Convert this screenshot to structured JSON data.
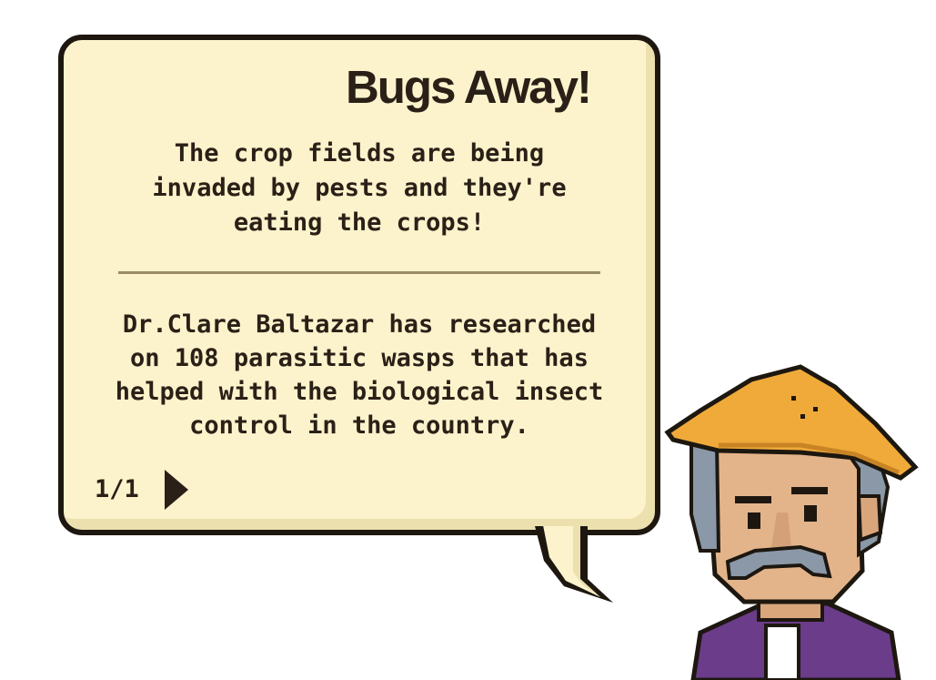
{
  "dialog": {
    "title": "Bugs Away!",
    "intro": "The crop fields are being invaded by pests and they're eating the crops!",
    "fact": "Dr.Clare Baltazar has researched on 108 parasitic wasps that has helped with the biological insect control in the country.",
    "page_counter": "1/1",
    "next_icon": "play-arrow-icon"
  },
  "character": {
    "name_icon": "farmer-icon",
    "hat_icon": "salakot-hat-icon"
  },
  "colors": {
    "bubble_fill": "#fcf3cc",
    "bubble_shadow": "#ece0ae",
    "outline": "#1d1710",
    "text": "#2b2017",
    "divider": "#9b8a68",
    "hat": "#f0aa3a",
    "skin": "#e3b48a",
    "hair": "#8a98a8",
    "shirt": "#6b3c8a"
  }
}
